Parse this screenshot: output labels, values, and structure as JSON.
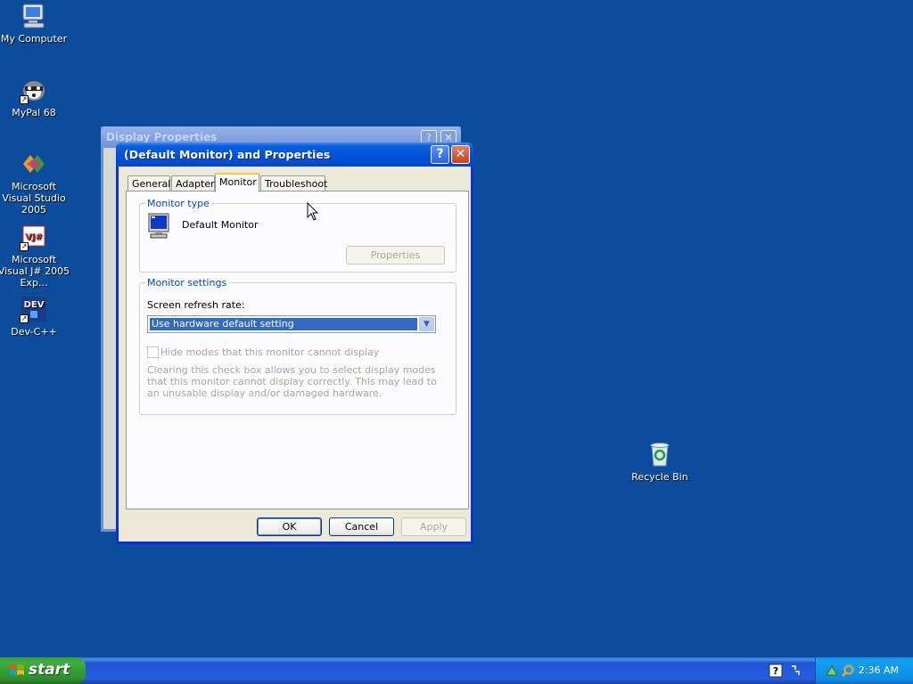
{
  "desktop": {
    "icons": [
      {
        "label": "My Computer"
      },
      {
        "label": "MyPal 68"
      },
      {
        "label": "Microsoft Visual Studio 2005"
      },
      {
        "label": "Microsoft Visual J# 2005 Exp..."
      },
      {
        "label": "Dev-C++"
      },
      {
        "label": "Recycle Bin"
      }
    ]
  },
  "back_window": {
    "title": "Display Properties"
  },
  "dialog": {
    "title": "(Default Monitor) and  Properties",
    "help_glyph": "?",
    "close_glyph": "✕",
    "tabs": [
      {
        "label": "General"
      },
      {
        "label": "Adapter"
      },
      {
        "label": "Monitor"
      },
      {
        "label": "Troubleshoot"
      }
    ],
    "active_tab": "Monitor",
    "monitor_type": {
      "legend": "Monitor type",
      "name": "Default Monitor",
      "properties_button": "Properties"
    },
    "monitor_settings": {
      "legend": "Monitor settings",
      "refresh_label": "Screen refresh rate:",
      "refresh_value": "Use hardware default setting",
      "hide_modes_label": "Hide modes that this monitor cannot display",
      "hide_modes_checked": false,
      "description": "Clearing this check box allows you to select display modes that this monitor cannot display correctly. This may lead to an unusable display and/or damaged hardware."
    },
    "buttons": {
      "ok": "OK",
      "cancel": "Cancel",
      "apply": "Apply"
    }
  },
  "taskbar": {
    "start_label": "start",
    "clock": "2:36 AM"
  },
  "colors": {
    "desktop": "#0b4c9c",
    "titlebar": "#0050d8",
    "accent_legend": "#0046d5",
    "selection": "#316ac5"
  }
}
